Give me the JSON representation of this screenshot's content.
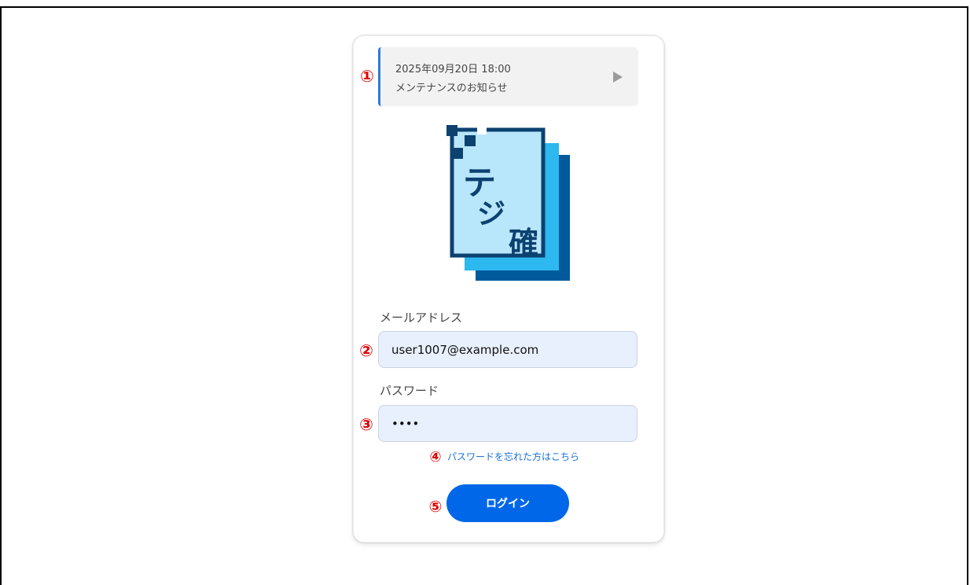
{
  "markers": {
    "m1": "①",
    "m2": "②",
    "m3": "③",
    "m4": "④",
    "m5": "⑤"
  },
  "notice": {
    "date": "2025年09月20日 18:00",
    "title": "メンテナンスのお知らせ",
    "arrow_icon": "play-arrow-icon"
  },
  "logo": {
    "text": "デジ確",
    "colors": {
      "dark": "#005a9c",
      "mid": "#2db8ef",
      "light": "#b8e6fb",
      "navy": "#0c4170"
    }
  },
  "form": {
    "email_label": "メールアドレス",
    "email_value": "user1007@example.com",
    "password_label": "パスワード",
    "password_value": "••••",
    "forgot_link": "パスワードを忘れた方はこちら",
    "login_button": "ログイン"
  },
  "colors": {
    "accent": "#0067e8",
    "notice_border": "#2f7bd8",
    "input_bg": "#e8f0fe",
    "link": "#1a6fd6",
    "marker": "#e00000"
  }
}
